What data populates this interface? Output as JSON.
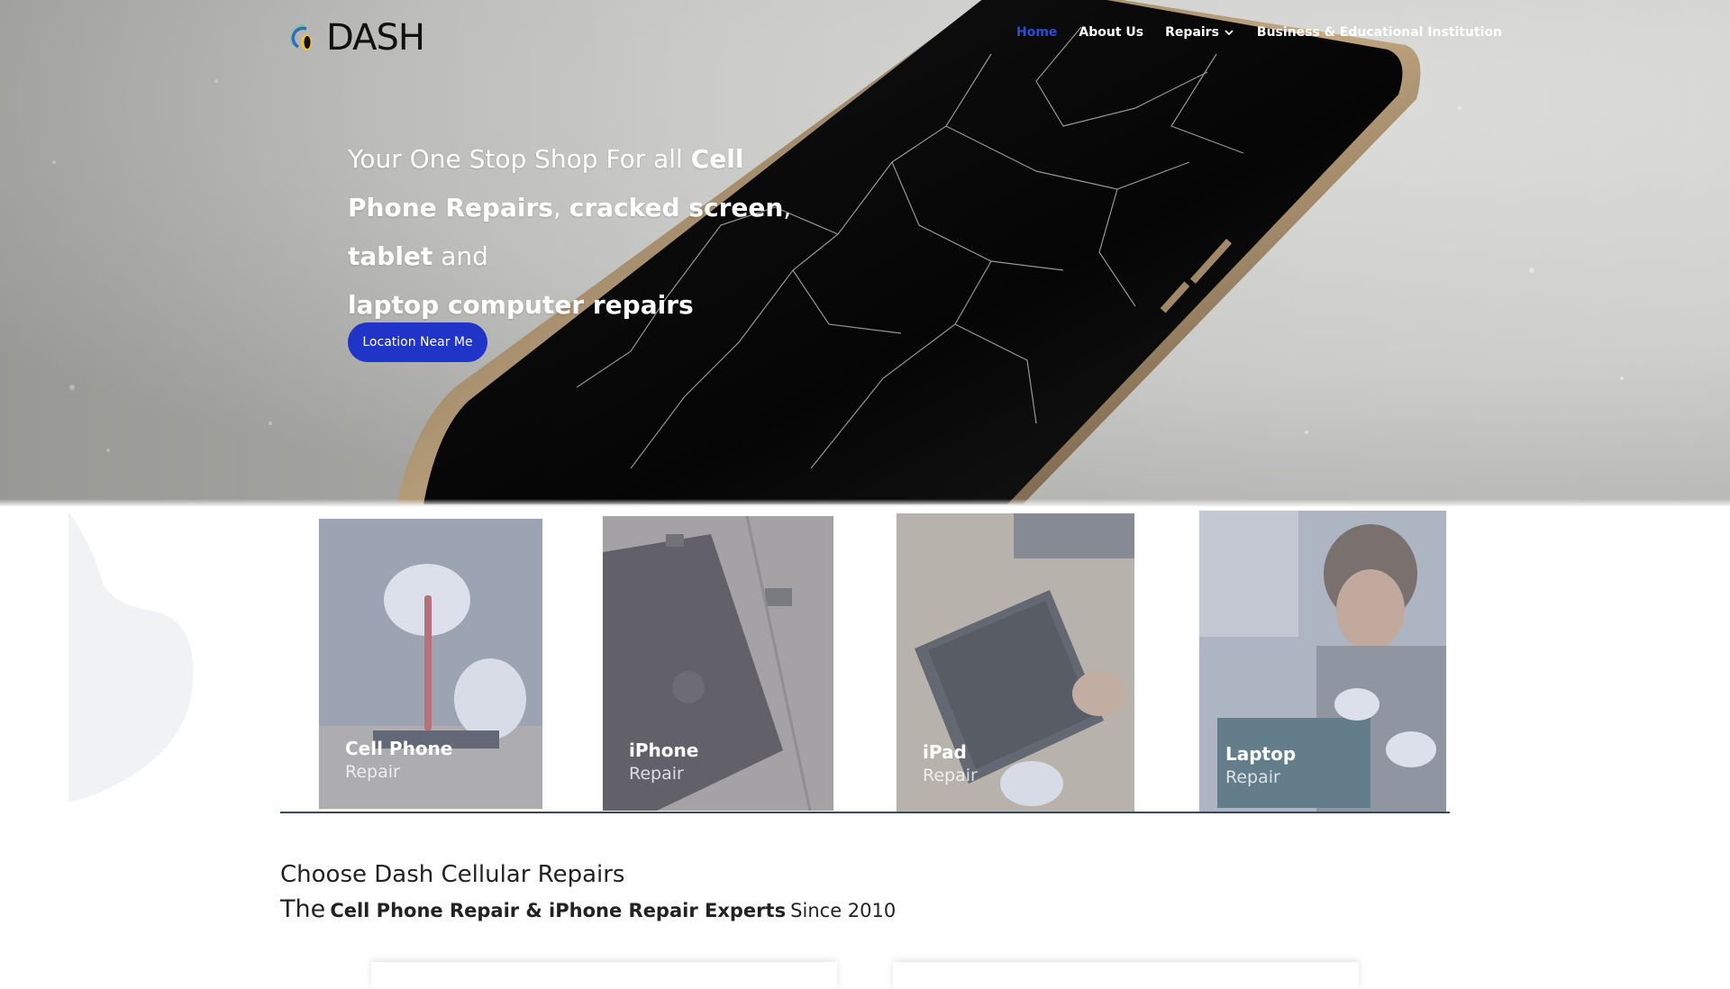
{
  "header": {
    "logo_text": "DASH",
    "nav": [
      {
        "label": "Home",
        "active": true
      },
      {
        "label": "About Us",
        "active": false
      },
      {
        "label": "Repairs",
        "active": false,
        "has_dropdown": true
      },
      {
        "label": "Business & Educational Institution",
        "active": false
      }
    ]
  },
  "hero": {
    "headline_parts": [
      {
        "text": "Your One Stop Shop For all ",
        "bold": false
      },
      {
        "text": "Cell Phone Repairs",
        "bold": true
      },
      {
        "text": ", ",
        "bold": false
      },
      {
        "text": "cracked screen",
        "bold": true
      },
      {
        "text": ", ",
        "bold": false
      },
      {
        "text": "tablet",
        "bold": true
      },
      {
        "text": " and ",
        "bold": false
      },
      {
        "text": "laptop computer repairs",
        "bold": true
      }
    ],
    "cta_label": "Location Near Me"
  },
  "services": [
    {
      "title": "Cell Phone",
      "subtitle": "Repair"
    },
    {
      "title": "iPhone",
      "subtitle": "Repair"
    },
    {
      "title": "iPad",
      "subtitle": "Repair"
    },
    {
      "title": "Laptop",
      "subtitle": "Repair"
    }
  ],
  "why": {
    "heading": "Choose Dash Cellular Repairs",
    "sub_prefix": "The",
    "sub_bold": "Cell Phone Repair & iPhone Repair Experts",
    "sub_suffix": "Since 2010"
  },
  "colors": {
    "accent_blue": "#2035c8",
    "nav_active": "#2d4bd6",
    "divider": "#39475a"
  },
  "icons": {
    "logo": "dash-logo-icon",
    "dropdown": "chevron-down-icon"
  }
}
